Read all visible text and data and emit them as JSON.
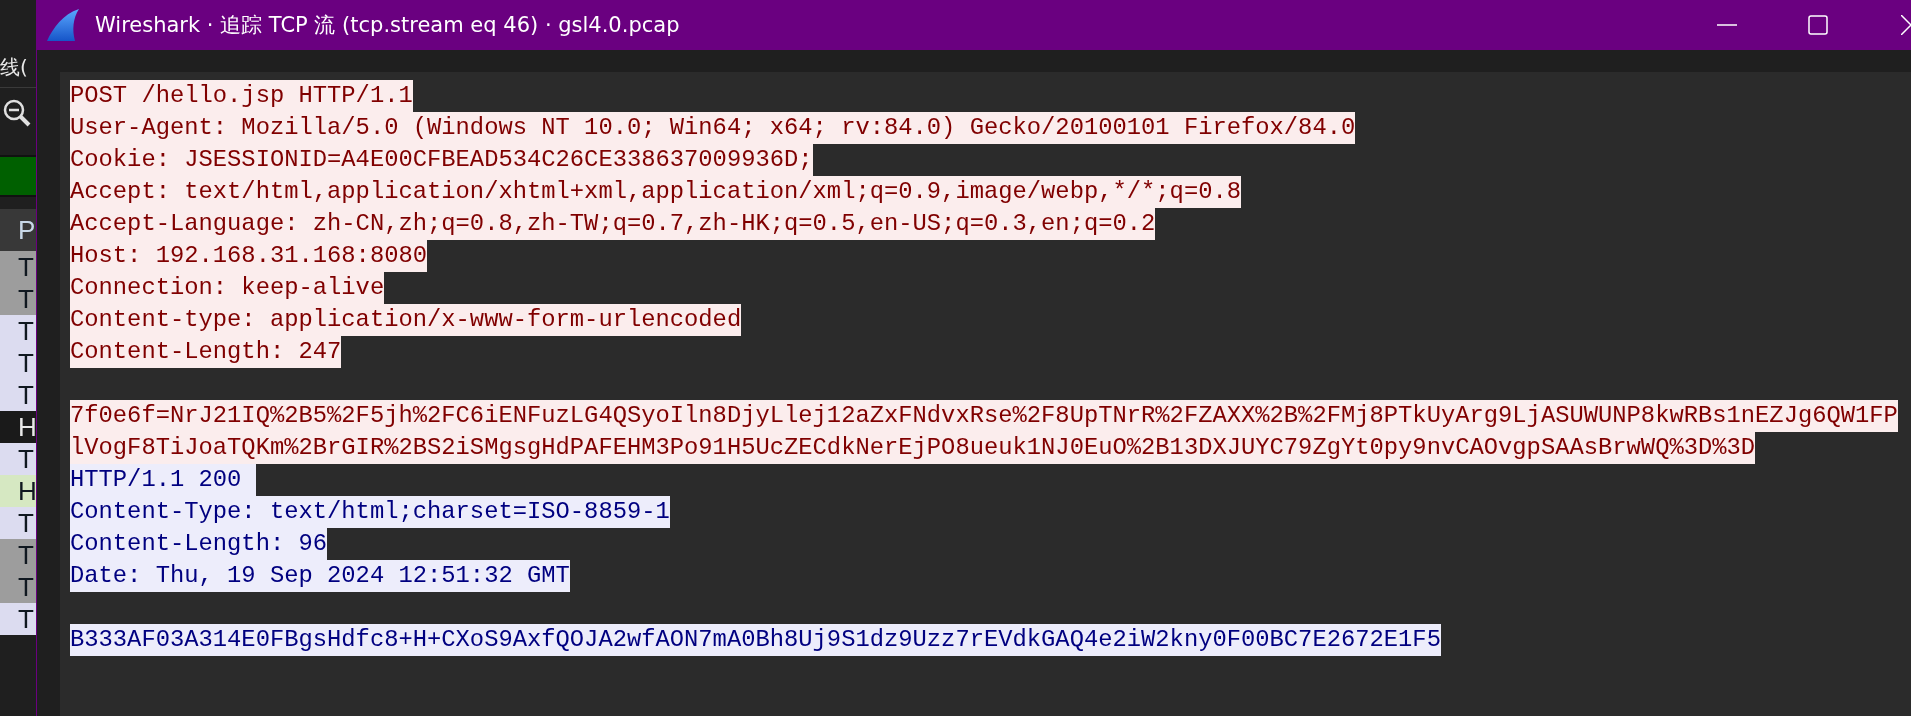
{
  "background_window": {
    "menu_label": "线(",
    "header": "P",
    "rows": [
      {
        "text": "T",
        "color": "#9d9d9d",
        "selected": false
      },
      {
        "text": "T",
        "color": "#9d9d9d",
        "selected": false
      },
      {
        "text": "T",
        "color": "#dcdcf0",
        "selected": false
      },
      {
        "text": "T",
        "color": "#dcdcf0",
        "selected": false
      },
      {
        "text": "T",
        "color": "#dcdcf0",
        "selected": false
      },
      {
        "text": "H",
        "selected": true
      },
      {
        "text": "T",
        "color": "#dcdcf0",
        "selected": false
      },
      {
        "text": "H",
        "color": "#d6e8c2",
        "selected": false
      },
      {
        "text": "T",
        "color": "#dcdcf0",
        "selected": false
      },
      {
        "text": "T",
        "color": "#9d9d9d",
        "selected": false
      },
      {
        "text": "T",
        "color": "#9d9d9d",
        "selected": false
      },
      {
        "text": "T",
        "color": "#dcdcf0",
        "selected": false
      }
    ]
  },
  "window": {
    "title": "Wireshark · 追踪 TCP 流 (tcp.stream eq 46) · gsl4.0.pcap"
  },
  "stream": [
    {
      "kind": "client",
      "lines": [
        {
          "kind": "text",
          "text": "POST /hello.jsp HTTP/1.1"
        },
        {
          "kind": "text",
          "text": "User-Agent: Mozilla/5.0 (Windows NT 10.0; Win64; x64; rv:84.0) Gecko/20100101 Firefox/84.0"
        },
        {
          "kind": "text",
          "text": "Cookie: JSESSIONID=A4E00CFBEAD534C26CE338637009936D;"
        },
        {
          "kind": "text",
          "text": "Accept: text/html,application/xhtml+xml,application/xml;q=0.9,image/webp,*/*;q=0.8"
        },
        {
          "kind": "text",
          "text": "Accept-Language: zh-CN,zh;q=0.8,zh-TW;q=0.7,zh-HK;q=0.5,en-US;q=0.3,en;q=0.2"
        },
        {
          "kind": "text",
          "text": "Host: 192.168.31.168:8080"
        },
        {
          "kind": "text",
          "text": "Connection: keep-alive"
        },
        {
          "kind": "text",
          "text": "Content-type: application/x-www-form-urlencoded"
        },
        {
          "kind": "text",
          "text": "Content-Length: 247"
        },
        {
          "kind": "blank"
        },
        {
          "kind": "text",
          "text": "7f0e6f=NrJ21IQ%2B5%2F5jh%2FC6iENFuzLG4QSyoIln8DjyLlej12aZxFNdvxRse%2F8UpTNrR%2FZAXX%2B%2FMj8PTkUyArg9LjASUWUNP8kwRBs1nEZJg6QW1FP"
        },
        {
          "kind": "text",
          "text": "lVogF8TiJoaTQKm%2BrGIR%2BS2iSMgsgHdPAFEHM3Po91H5UcZECdkNerEjPO8ueuk1NJ0EuO%2B13DXJUYC79ZgYt0py9nvCAOvgpSAAsBrwWQ%3D%3D"
        }
      ]
    },
    {
      "kind": "server",
      "lines": [
        {
          "kind": "text",
          "text": "HTTP/1.1 200 "
        },
        {
          "kind": "text",
          "text": "Content-Type: text/html;charset=ISO-8859-1"
        },
        {
          "kind": "text",
          "text": "Content-Length: 96"
        },
        {
          "kind": "text",
          "text": "Date: Thu, 19 Sep 2024 12:51:32 GMT"
        },
        {
          "kind": "blank"
        },
        {
          "kind": "text",
          "text": "B333AF03A314E0FBgsHdfc8+H+CXoS9AxfQOJA2wfAON7mA0Bh8Uj9S1dz9Uzz7rEVdkGAQ4e2iW2kny0F00BC7E2672E1F5"
        }
      ]
    }
  ]
}
